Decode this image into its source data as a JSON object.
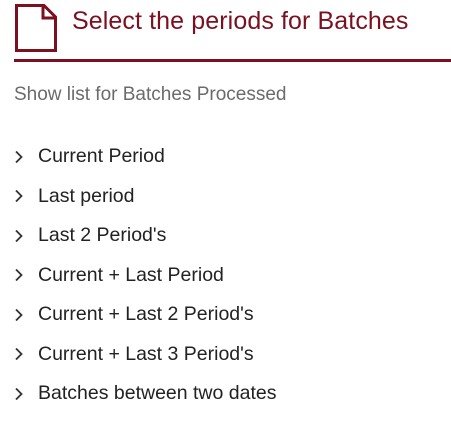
{
  "header": {
    "title": "Select the periods for Batches",
    "icon": "document-icon",
    "accent_color": "#7a1020"
  },
  "subtitle": "Show list for Batches Processed",
  "periods": [
    {
      "label": "Current Period",
      "icon": "chevron-right-icon"
    },
    {
      "label": "Last period",
      "icon": "chevron-right-icon"
    },
    {
      "label": "Last 2 Period's",
      "icon": "chevron-right-icon"
    },
    {
      "label": "Current + Last Period",
      "icon": "chevron-right-icon"
    },
    {
      "label": "Current + Last 2 Period's",
      "icon": "chevron-right-icon"
    },
    {
      "label": "Current + Last 3 Period's",
      "icon": "chevron-right-icon"
    },
    {
      "label": "Batches between two dates",
      "icon": "chevron-right-icon"
    }
  ]
}
